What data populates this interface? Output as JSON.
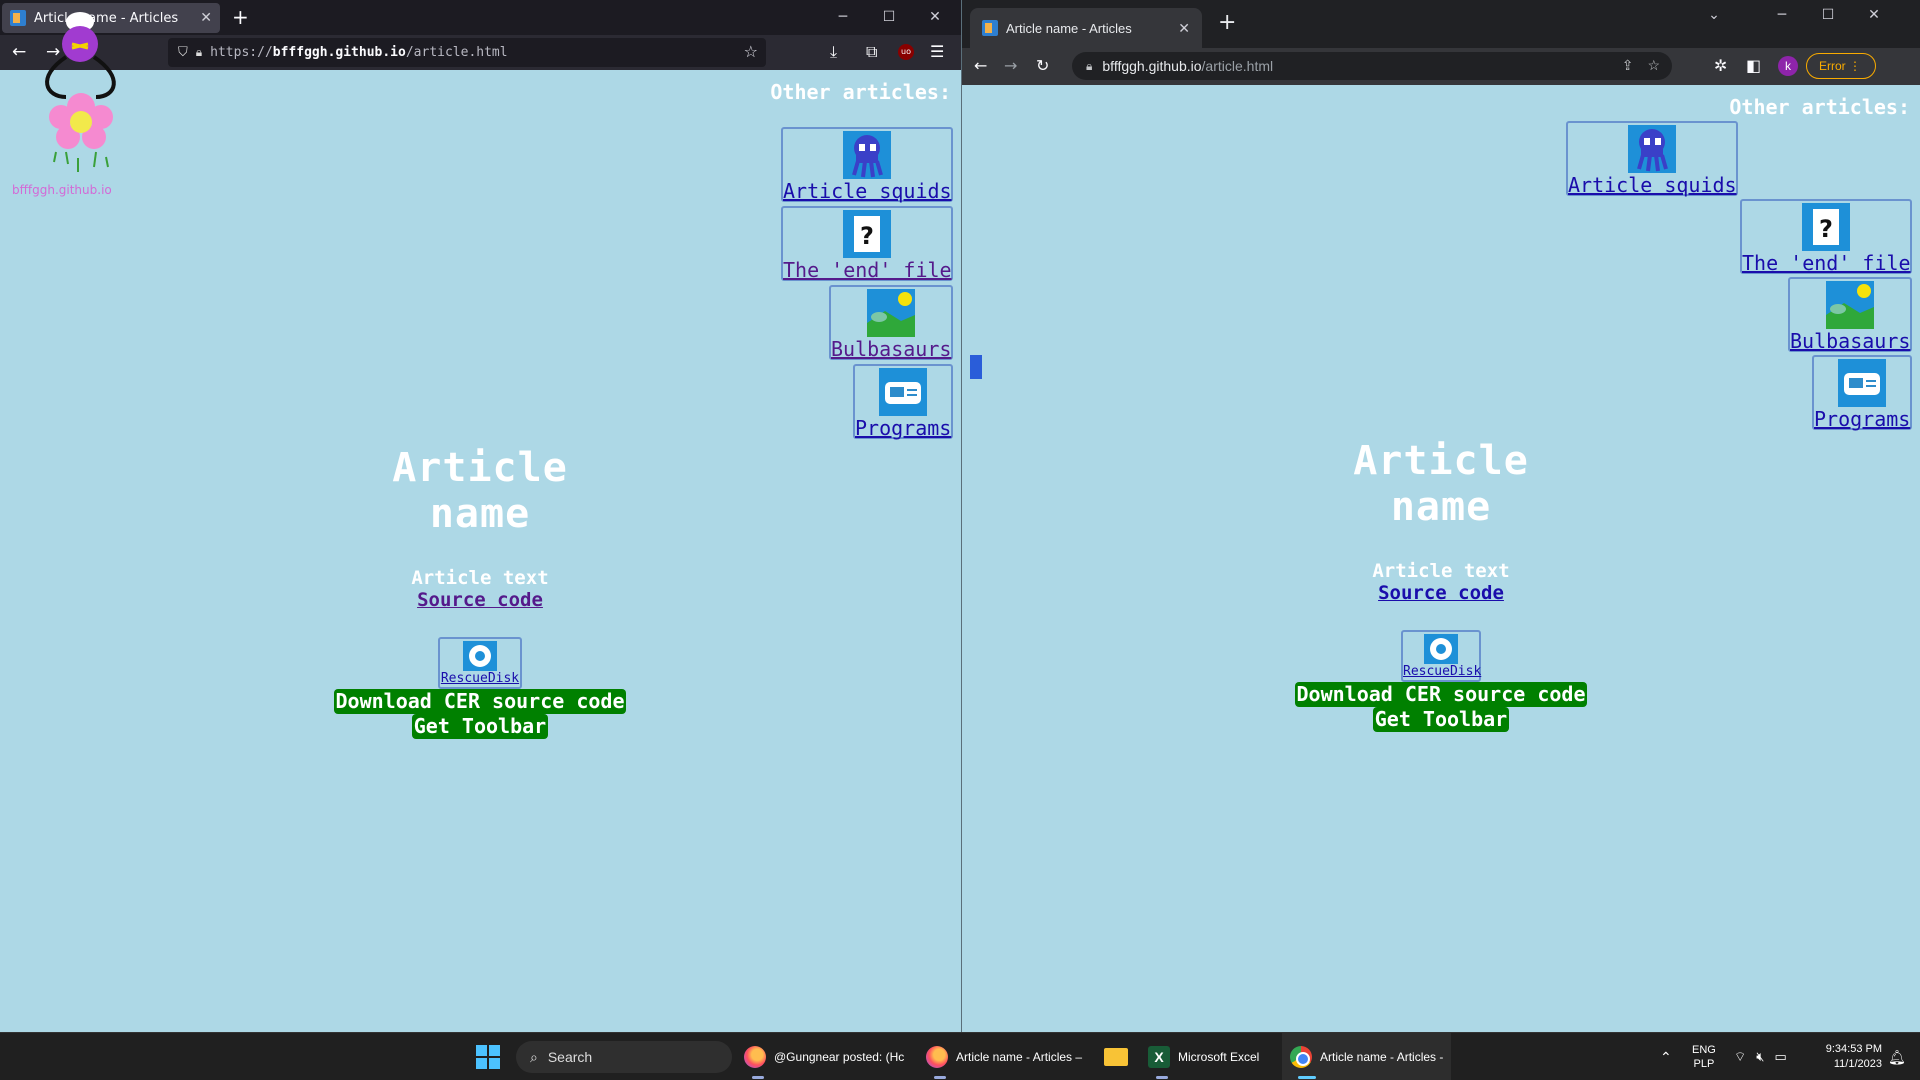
{
  "left_browser": {
    "tab_title": "Article name - Articles",
    "url_prefix": "https://",
    "url_host": "bfffggh.github.io",
    "url_path": "/article.html",
    "watermark": "bfffggh.github.io"
  },
  "right_browser": {
    "tab_title": "Article name - Articles",
    "url_host": "bfffggh.github.io",
    "url_path": "/article.html",
    "profile_initial": "k",
    "error_label": "Error"
  },
  "page": {
    "other_articles": "Other articles:",
    "articles": [
      {
        "label": "Article squids",
        "icon": "squid-icon"
      },
      {
        "label": "The 'end' file",
        "icon": "question-file-icon"
      },
      {
        "label": "Bulbasaurs",
        "icon": "landscape-image-icon"
      },
      {
        "label": "Programs",
        "icon": "program-card-icon"
      }
    ],
    "title": "Article name",
    "article_text": "Article text",
    "source_code": "Source code",
    "rescue_disk": "RescueDisk",
    "download_button": "Download CER source code",
    "toolbar_button": "Get Toolbar"
  },
  "taskbar": {
    "search_placeholder": "Search",
    "items": [
      {
        "label": "@Gungnear posted: (Hc",
        "icon": "firefox-icon"
      },
      {
        "label": "Article name - Articles –",
        "icon": "firefox-icon"
      },
      {
        "label": "",
        "icon": "file-explorer-icon"
      },
      {
        "label": "Microsoft Excel",
        "icon": "excel-icon"
      },
      {
        "label": "Article name - Articles -",
        "icon": "chrome-icon"
      }
    ],
    "lang_top": "ENG",
    "lang_bottom": "PLP",
    "time": "9:34:53 PM",
    "date": "11/1/2023"
  }
}
